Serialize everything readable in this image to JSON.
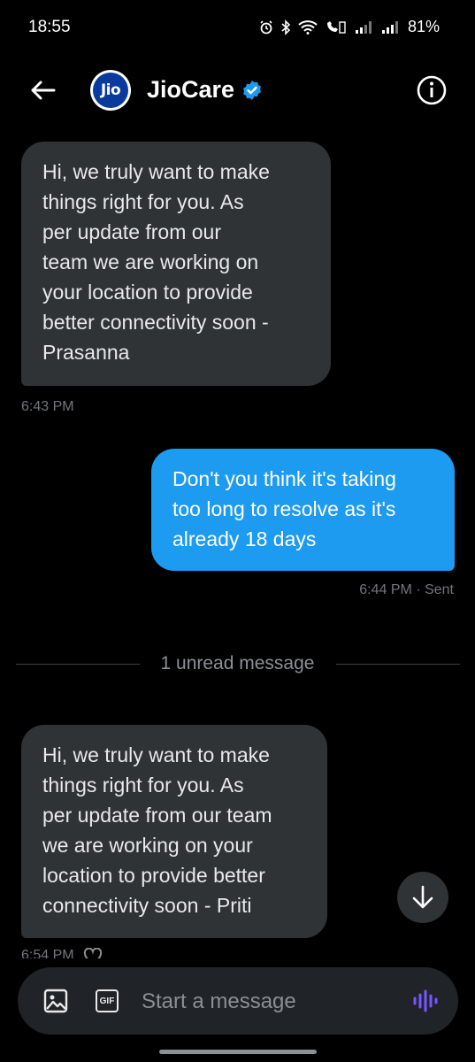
{
  "status_bar": {
    "time": "18:55",
    "battery": "81%",
    "icons": [
      "alarm-icon",
      "bluetooth-icon",
      "wifi-icon",
      "volte-icon",
      "signal-icon",
      "signal-icon"
    ]
  },
  "header": {
    "avatar_text": "Jio",
    "title": "JioCare",
    "verified": true,
    "accent_color": "#1d9bf0"
  },
  "messages": [
    {
      "direction": "incoming",
      "text": "Hi, we truly want to make\nthings right for you. As\nper update  from our\nteam we are working on\nyour location to provide\nbetter connectivity soon -\nPrasanna",
      "time": "6:43 PM"
    },
    {
      "direction": "outgoing",
      "text": "Don't you think it's taking\ntoo long to resolve as it's\nalready 18 days",
      "time": "6:44 PM · Sent"
    },
    {
      "direction": "incoming",
      "text": "Hi, we truly want to make\nthings right for you. As\nper update from our team\nwe are working on your\nlocation to provide better\nconnectivity soon - Priti",
      "time": "6:54 PM"
    }
  ],
  "unread_divider": "1 unread message",
  "composer": {
    "placeholder": "Start a message",
    "gif_label": "GIF"
  }
}
